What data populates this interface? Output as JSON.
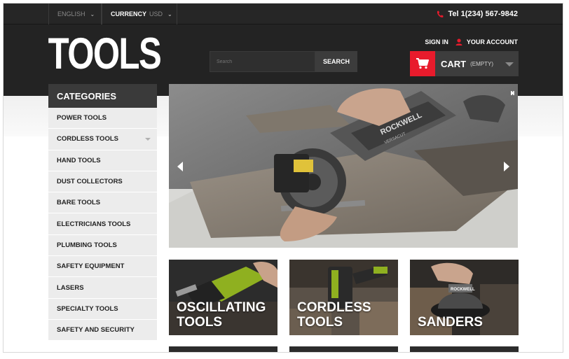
{
  "topbar": {
    "language": "English",
    "currency_label": "Currency",
    "currency_value": "USD",
    "phone": "Tel 1(234) 567-9842",
    "icons": {
      "dropdown": "chevron-down-icon",
      "phone": "phone-icon"
    }
  },
  "header": {
    "logo_text": "TOOLS",
    "search_placeholder": "Search",
    "search_button": "Search",
    "sign_in": "Sign in",
    "your_account": "Your Account",
    "cart_label": "Cart",
    "cart_status": "(empty)",
    "icons": {
      "user": "user-icon",
      "cart": "cart-icon"
    }
  },
  "categories": {
    "title": "Categories",
    "items": [
      "Power Tools",
      "Cordless Tools",
      "Hand Tools",
      "Dust Collectors",
      "Bare Tools",
      "Electricians Tools",
      "Plumbing Tools",
      "Safety Equipment",
      "Lasers",
      "Specialty Tools",
      "Safety and Security"
    ]
  },
  "slider": {
    "brand_text": "ROCKWELL",
    "model_text": "VERSACUT",
    "icons": {
      "prev": "chevron-left-icon",
      "next": "chevron-right-icon",
      "play_pause": "play-pause-icon"
    }
  },
  "promos": [
    {
      "title": "Oscillating Tools"
    },
    {
      "title": "Cordless Tools"
    },
    {
      "title": "Sanders",
      "brand_text": "ROCKWELL"
    }
  ],
  "colors": {
    "accent": "#e81b2c",
    "dark": "#232323",
    "topbar": "#262626",
    "category_bg": "#ececec"
  }
}
